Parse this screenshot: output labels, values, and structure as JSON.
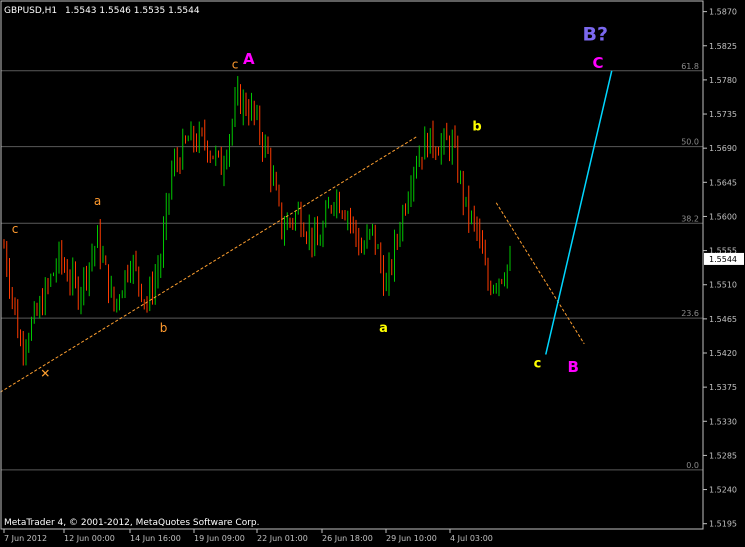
{
  "header": {
    "symbol": "GBPUSD,H1",
    "ohlc": "1.5543 1.5546 1.5535 1.5544"
  },
  "footer": {
    "copyright": "MetaTrader 4, © 2001-2012, MetaQuotes Software Corp."
  },
  "colors": {
    "background": "#000000",
    "axis": "#c0c0c0",
    "bull": "#00c800",
    "bear": "#ff3a00",
    "fib": "#5a5a5a",
    "fibText": "#8a8a8a",
    "orangeWave": "#ff9a2e",
    "yellowWave": "#ffff00",
    "magentaWave": "#ff00ff",
    "purpleText": "#7b68ee",
    "projection": "#00d7ff",
    "trendline": "#ffa030"
  },
  "chart_data": {
    "type": "candlestick",
    "instrument": "GBPUSD",
    "timeframe": "H1",
    "ylim": [
      1.5188,
      1.5884
    ],
    "y_ticks": [
      "1.5870",
      "1.5825",
      "1.5780",
      "1.5735",
      "1.5690",
      "1.5645",
      "1.5600",
      "1.5555",
      "1.5510",
      "1.5465",
      "1.5420",
      "1.5375",
      "1.5330",
      "1.5285",
      "1.5240",
      "1.5195"
    ],
    "x_ticks": [
      "7 Jun 2012",
      "12 Jun 00:00",
      "14 Jun 16:00",
      "19 Jun 09:00",
      "22 Jun 01:00",
      "26 Jun 18:00",
      "29 Jun 10:00",
      "4 Jul 03:00"
    ],
    "current_price": "1.5544",
    "price_anchors": [
      [
        0,
        1.556
      ],
      [
        6,
        1.543
      ],
      [
        12,
        1.547
      ],
      [
        20,
        1.5545
      ],
      [
        27,
        1.55
      ],
      [
        34,
        1.557
      ],
      [
        40,
        1.548
      ],
      [
        46,
        1.5545
      ],
      [
        52,
        1.5485
      ],
      [
        57,
        1.5545
      ],
      [
        61,
        1.566
      ],
      [
        67,
        1.57
      ],
      [
        73,
        1.57
      ],
      [
        79,
        1.5665
      ],
      [
        85,
        1.5755
      ],
      [
        90,
        1.574
      ],
      [
        96,
        1.568
      ],
      [
        101,
        1.5585
      ],
      [
        107,
        1.5605
      ],
      [
        114,
        1.556
      ],
      [
        120,
        1.563
      ],
      [
        125,
        1.5605
      ],
      [
        130,
        1.5555
      ],
      [
        134,
        1.558
      ],
      [
        139,
        1.5505
      ],
      [
        144,
        1.559
      ],
      [
        149,
        1.567
      ],
      [
        154,
        1.57
      ],
      [
        158,
        1.5695
      ],
      [
        163,
        1.5695
      ],
      [
        168,
        1.561
      ],
      [
        172,
        1.558
      ],
      [
        176,
        1.551
      ],
      [
        181,
        1.5525
      ],
      [
        184,
        1.554
      ]
    ],
    "fib_levels": [
      {
        "label": "61.8",
        "price": 1.5792
      },
      {
        "label": "50.0",
        "price": 1.5692
      },
      {
        "label": "38.2",
        "price": 1.5591
      },
      {
        "label": "23.6",
        "price": 1.5466
      },
      {
        "label": "0.0",
        "price": 1.5266
      }
    ],
    "annotations": [
      {
        "text": "c",
        "group": "orange",
        "bar": 4,
        "price": 1.5578
      },
      {
        "text": "a",
        "group": "orange",
        "bar": 34,
        "price": 1.5615
      },
      {
        "text": "b",
        "group": "orange",
        "bar": 58,
        "price": 1.5448
      },
      {
        "text": "c",
        "group": "orange",
        "bar": 84,
        "price": 1.5795
      },
      {
        "text": "A",
        "group": "magenta",
        "bar": 89,
        "price": 1.5801
      },
      {
        "text": "a",
        "group": "yellow",
        "bar": 138,
        "price": 1.5448
      },
      {
        "text": "b",
        "group": "yellow",
        "bar": 172,
        "price": 1.5713
      },
      {
        "text": "c",
        "group": "yellow",
        "bar": 194,
        "price": 1.5401
      },
      {
        "text": "B",
        "group": "magenta",
        "bar": 207,
        "price": 1.5395
      },
      {
        "text": "C",
        "group": "magenta",
        "bar": 216,
        "price": 1.5796
      },
      {
        "text": "B?",
        "group": "purple",
        "bar": 215,
        "price": 1.5832
      }
    ],
    "lines": [
      {
        "name": "support-trendline",
        "style": "dashed",
        "from": {
          "bar": -6,
          "price": 1.5358
        },
        "to": {
          "bar": 150,
          "price": 1.5705
        }
      },
      {
        "name": "projection-dashed",
        "style": "dashed",
        "from": {
          "bar": 179,
          "price": 1.5618
        },
        "to": {
          "bar": 211,
          "price": 1.5432
        }
      },
      {
        "name": "projection-solid",
        "style": "solid",
        "from": {
          "bar": 197,
          "price": 1.5418
        },
        "to": {
          "bar": 221,
          "price": 1.5792
        }
      }
    ],
    "markers": [
      {
        "name": "x-marker",
        "text": "✕",
        "bar": 15,
        "price": 1.5393
      }
    ]
  }
}
